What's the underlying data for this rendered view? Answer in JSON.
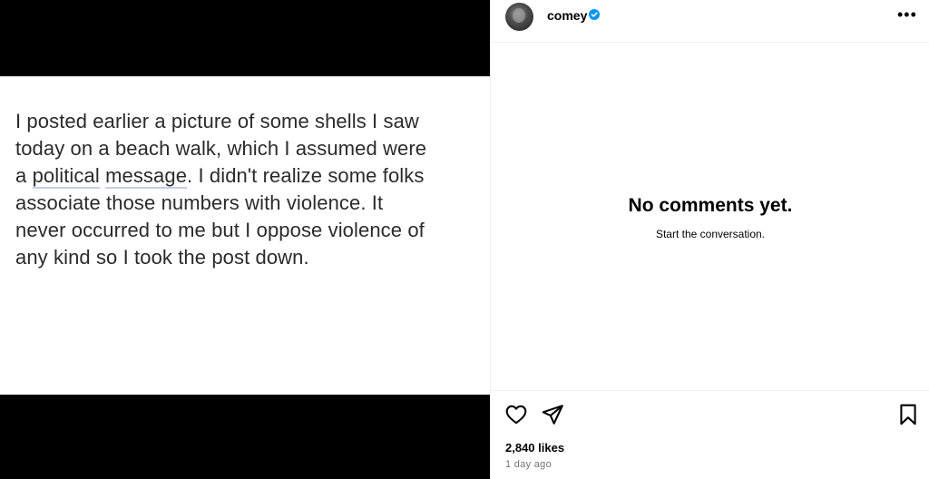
{
  "post": {
    "line1": "I posted earlier a picture of some shells I saw",
    "line2": "today on a beach walk, which I assumed were",
    "line3_pre": "a ",
    "line3_u1": "political",
    "line3_mid": " ",
    "line3_u2": "message",
    "line3_post": ". I didn't realize some folks",
    "line4": "associate those numbers with violence. It",
    "line5": "never occurred to me but I oppose violence of",
    "line6": "any kind so I took the post down."
  },
  "header": {
    "username": "comey",
    "avatar_icon": "profile-avatar",
    "verified_icon": "verified-badge-icon",
    "more_label": "•••"
  },
  "comments": {
    "empty_title": "No comments yet.",
    "empty_subtitle": "Start the conversation."
  },
  "actions": {
    "like_icon": "heart-icon",
    "share_icon": "send-icon",
    "save_icon": "bookmark-icon",
    "likes_text": "2,840 likes",
    "time_text": "1 day ago"
  },
  "colors": {
    "verified_blue": "#0095f6",
    "underline": "#c6cdea",
    "muted_text": "#737373"
  }
}
